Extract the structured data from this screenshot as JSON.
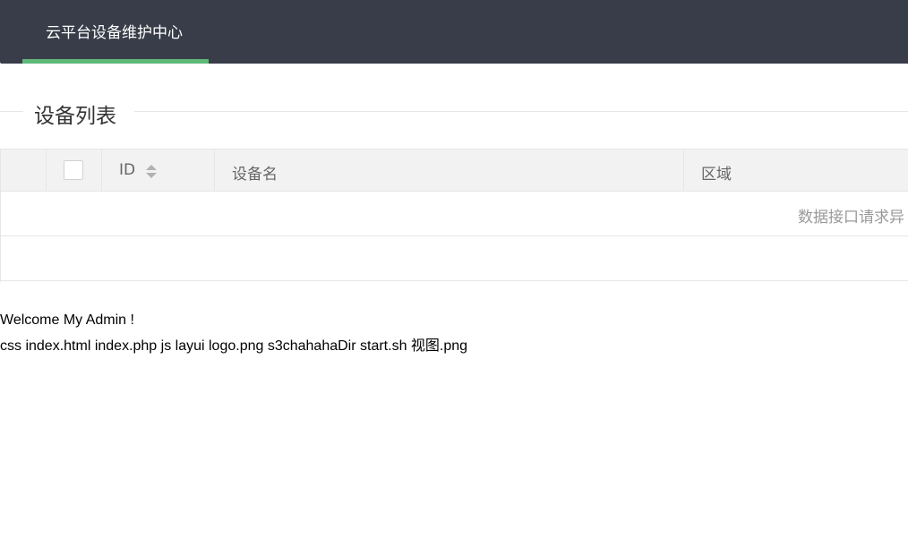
{
  "header": {
    "nav_title": "云平台设备维护中心"
  },
  "section": {
    "legend": "设备列表"
  },
  "table": {
    "columns": {
      "id": "ID",
      "device_name": "设备名",
      "region": "区域"
    },
    "empty_message": "数据接口请求异"
  },
  "footer": {
    "welcome": "Welcome My Admin !",
    "file_list": "css index.html index.php js layui logo.png s3chahahaDir start.sh 视图.png"
  },
  "colors": {
    "header_bg": "#393d49",
    "nav_active_bar": "#5fb878",
    "table_head_bg": "#f2f2f2"
  }
}
